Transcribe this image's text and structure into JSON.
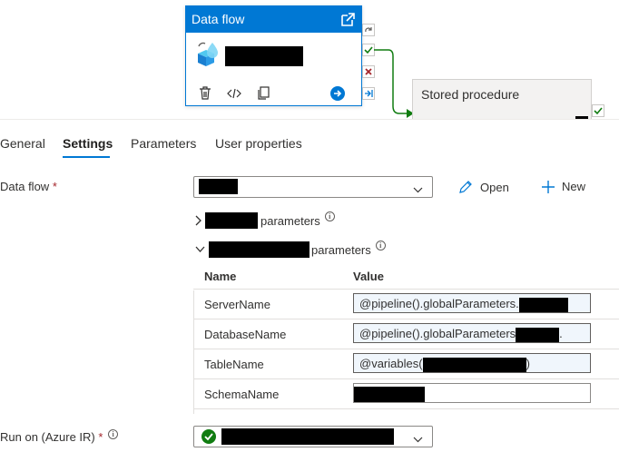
{
  "canvas": {
    "activity_title": "Data flow",
    "stored_procedure_title": "Stored procedure"
  },
  "tabs": [
    "General",
    "Settings",
    "Parameters",
    "User properties"
  ],
  "active_tab": "Settings",
  "form": {
    "dataflow_label": "Data flow",
    "required_mark": "*",
    "open_label": "Open",
    "new_label": "New",
    "group1_suffix": "parameters",
    "group2_suffix": "parameters",
    "info_glyph": "i",
    "runon_label": "Run on (Azure IR)"
  },
  "params_table": {
    "headers": {
      "name": "Name",
      "value": "Value"
    },
    "rows": [
      {
        "name": "ServerName",
        "value": "@pipeline().globalParameters."
      },
      {
        "name": "DatabaseName",
        "value": "@pipeline().globalParameters"
      },
      {
        "name": "TableName",
        "value": "@variables("
      },
      {
        "name": "SchemaName",
        "value": ""
      }
    ],
    "value_suffixes": {
      "db": ".",
      "table": ")"
    }
  },
  "colors": {
    "accent": "#0078d4",
    "success": "#107c10",
    "error": "#a4262c",
    "required": "#a4262c"
  },
  "icons": [
    "external-link-icon",
    "dataflow-icon",
    "delete-icon",
    "code-icon",
    "copy-icon",
    "arrow-right-icon",
    "redo-icon",
    "check-icon",
    "close-icon",
    "chevron-down-icon",
    "chevron-right-icon",
    "pencil-icon",
    "plus-icon",
    "info-icon",
    "check-circle-icon"
  ]
}
